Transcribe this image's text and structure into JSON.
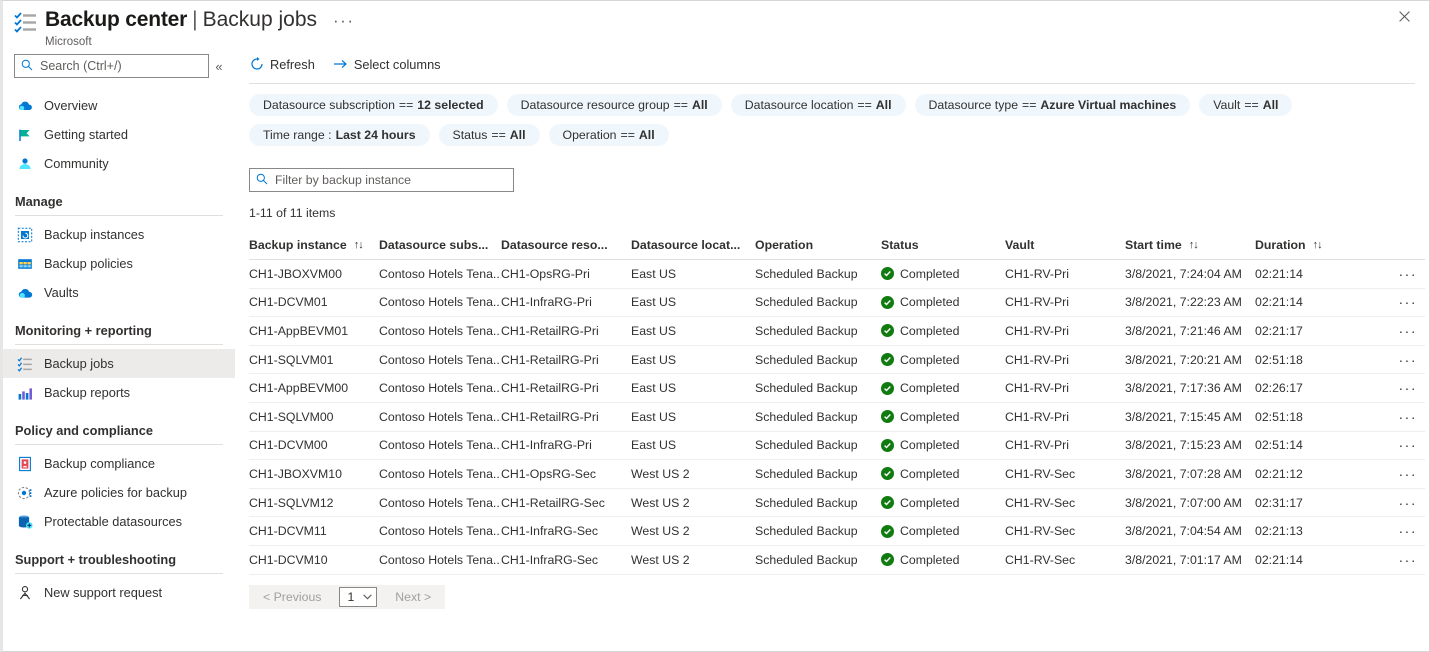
{
  "header": {
    "icon": "backup-jobs-checklist-icon",
    "title": "Backup center",
    "separator": "|",
    "subtitle": "Backup jobs",
    "ellipsis": "···",
    "publisher": "Microsoft",
    "close_icon": "✕"
  },
  "sidebar": {
    "search": {
      "placeholder": "Search (Ctrl+/)",
      "value": "",
      "icon": "search-icon"
    },
    "collapse_icon": "«",
    "top_items": [
      {
        "label": "Overview",
        "icon": "overview-cloud-icon"
      },
      {
        "label": "Getting started",
        "icon": "flag-icon"
      },
      {
        "label": "Community",
        "icon": "community-icon"
      }
    ],
    "groups": [
      {
        "title": "Manage",
        "items": [
          {
            "label": "Backup instances",
            "icon": "backup-instances-icon"
          },
          {
            "label": "Backup policies",
            "icon": "backup-policies-icon"
          },
          {
            "label": "Vaults",
            "icon": "vaults-icon"
          }
        ]
      },
      {
        "title": "Monitoring + reporting",
        "items": [
          {
            "label": "Backup jobs",
            "icon": "backup-jobs-icon",
            "selected": true
          },
          {
            "label": "Backup reports",
            "icon": "backup-reports-icon"
          }
        ]
      },
      {
        "title": "Policy and compliance",
        "items": [
          {
            "label": "Backup compliance",
            "icon": "backup-compliance-icon"
          },
          {
            "label": "Azure policies for backup",
            "icon": "azure-policy-icon"
          },
          {
            "label": "Protectable datasources",
            "icon": "protectable-datasources-icon"
          }
        ]
      },
      {
        "title": "Support + troubleshooting",
        "items": [
          {
            "label": "New support request",
            "icon": "support-person-icon"
          }
        ]
      }
    ]
  },
  "toolbar": {
    "refresh_label": "Refresh",
    "refresh_icon": "refresh-icon",
    "select_columns_label": "Select columns",
    "select_columns_icon": "arrow-right-icon"
  },
  "filters": {
    "row1": [
      {
        "key": "Datasource subscription",
        "op": "==",
        "value": "12 selected"
      },
      {
        "key": "Datasource resource group",
        "op": "==",
        "value": "All"
      },
      {
        "key": "Datasource location",
        "op": "==",
        "value": "All"
      },
      {
        "key": "Datasource type",
        "op": "==",
        "value": "Azure Virtual machines"
      },
      {
        "key": "Vault",
        "op": "==",
        "value": "All"
      }
    ],
    "row2": [
      {
        "key": "Time range :",
        "op": "",
        "value": "Last 24 hours"
      },
      {
        "key": "Status",
        "op": "==",
        "value": "All"
      },
      {
        "key": "Operation",
        "op": "==",
        "value": "All"
      }
    ]
  },
  "instance_filter": {
    "placeholder": "Filter by backup instance",
    "value": "",
    "icon": "search-icon"
  },
  "results_count": "1-11 of 11 items",
  "table": {
    "columns": [
      {
        "label": "Backup instance",
        "sortable": true
      },
      {
        "label": "Datasource subs...",
        "sortable": false
      },
      {
        "label": "Datasource reso...",
        "sortable": false
      },
      {
        "label": "Datasource locat...",
        "sortable": false
      },
      {
        "label": "Operation",
        "sortable": false
      },
      {
        "label": "Status",
        "sortable": false
      },
      {
        "label": "Vault",
        "sortable": false
      },
      {
        "label": "Start time",
        "sortable": true
      },
      {
        "label": "Duration",
        "sortable": true
      },
      {
        "label": "",
        "sortable": false
      }
    ],
    "sort_icon": "↑↓",
    "row_menu_icon": "···",
    "status_icon": "check-circle-icon",
    "rows": [
      {
        "instance": "CH1-JBOXVM00",
        "subscription": "Contoso Hotels Tena...",
        "resource_group": "CH1-OpsRG-Pri",
        "location": "East US",
        "operation": "Scheduled Backup",
        "status": "Completed",
        "vault": "CH1-RV-Pri",
        "start_time": "3/8/2021, 7:24:04 AM",
        "duration": "02:21:14"
      },
      {
        "instance": "CH1-DCVM01",
        "subscription": "Contoso Hotels Tena...",
        "resource_group": "CH1-InfraRG-Pri",
        "location": "East US",
        "operation": "Scheduled Backup",
        "status": "Completed",
        "vault": "CH1-RV-Pri",
        "start_time": "3/8/2021, 7:22:23 AM",
        "duration": "02:21:14"
      },
      {
        "instance": "CH1-AppBEVM01",
        "subscription": "Contoso Hotels Tena...",
        "resource_group": "CH1-RetailRG-Pri",
        "location": "East US",
        "operation": "Scheduled Backup",
        "status": "Completed",
        "vault": "CH1-RV-Pri",
        "start_time": "3/8/2021, 7:21:46 AM",
        "duration": "02:21:17"
      },
      {
        "instance": "CH1-SQLVM01",
        "subscription": "Contoso Hotels Tena...",
        "resource_group": "CH1-RetailRG-Pri",
        "location": "East US",
        "operation": "Scheduled Backup",
        "status": "Completed",
        "vault": "CH1-RV-Pri",
        "start_time": "3/8/2021, 7:20:21 AM",
        "duration": "02:51:18"
      },
      {
        "instance": "CH1-AppBEVM00",
        "subscription": "Contoso Hotels Tena...",
        "resource_group": "CH1-RetailRG-Pri",
        "location": "East US",
        "operation": "Scheduled Backup",
        "status": "Completed",
        "vault": "CH1-RV-Pri",
        "start_time": "3/8/2021, 7:17:36 AM",
        "duration": "02:26:17"
      },
      {
        "instance": "CH1-SQLVM00",
        "subscription": "Contoso Hotels Tena...",
        "resource_group": "CH1-RetailRG-Pri",
        "location": "East US",
        "operation": "Scheduled Backup",
        "status": "Completed",
        "vault": "CH1-RV-Pri",
        "start_time": "3/8/2021, 7:15:45 AM",
        "duration": "02:51:18"
      },
      {
        "instance": "CH1-DCVM00",
        "subscription": "Contoso Hotels Tena...",
        "resource_group": "CH1-InfraRG-Pri",
        "location": "East US",
        "operation": "Scheduled Backup",
        "status": "Completed",
        "vault": "CH1-RV-Pri",
        "start_time": "3/8/2021, 7:15:23 AM",
        "duration": "02:51:14"
      },
      {
        "instance": "CH1-JBOXVM10",
        "subscription": "Contoso Hotels Tena...",
        "resource_group": "CH1-OpsRG-Sec",
        "location": "West US 2",
        "operation": "Scheduled Backup",
        "status": "Completed",
        "vault": "CH1-RV-Sec",
        "start_time": "3/8/2021, 7:07:28 AM",
        "duration": "02:21:12"
      },
      {
        "instance": "CH1-SQLVM12",
        "subscription": "Contoso Hotels Tena...",
        "resource_group": "CH1-RetailRG-Sec",
        "location": "West US 2",
        "operation": "Scheduled Backup",
        "status": "Completed",
        "vault": "CH1-RV-Sec",
        "start_time": "3/8/2021, 7:07:00 AM",
        "duration": "02:31:17"
      },
      {
        "instance": "CH1-DCVM11",
        "subscription": "Contoso Hotels Tena...",
        "resource_group": "CH1-InfraRG-Sec",
        "location": "West US 2",
        "operation": "Scheduled Backup",
        "status": "Completed",
        "vault": "CH1-RV-Sec",
        "start_time": "3/8/2021, 7:04:54 AM",
        "duration": "02:21:13"
      },
      {
        "instance": "CH1-DCVM10",
        "subscription": "Contoso Hotels Tena...",
        "resource_group": "CH1-InfraRG-Sec",
        "location": "West US 2",
        "operation": "Scheduled Backup",
        "status": "Completed",
        "vault": "CH1-RV-Sec",
        "start_time": "3/8/2021, 7:01:17 AM",
        "duration": "02:21:14"
      }
    ]
  },
  "pager": {
    "previous_label": "< Previous",
    "page_value": "1",
    "page_chevron": "∨",
    "next_label": "Next >"
  },
  "colors": {
    "accent": "#0078d4",
    "pill_bg": "#eff6fc",
    "success": "#107c10",
    "selected_nav_bg": "#edebe9"
  }
}
